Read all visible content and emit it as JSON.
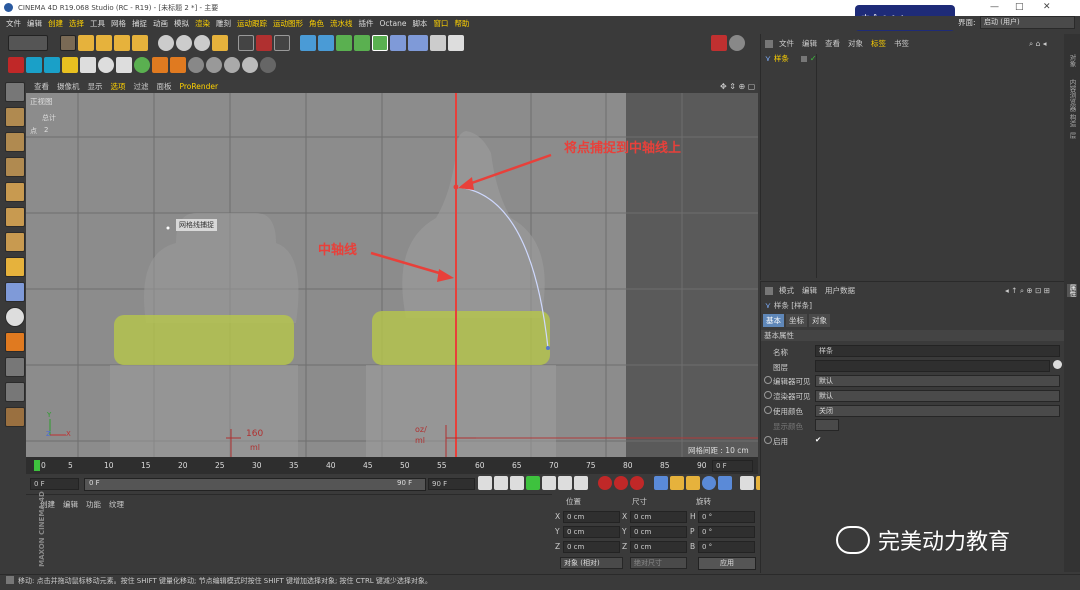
{
  "window": {
    "title": "CINEMA 4D R19.068 Studio (RC - R19) - [未标题 2 *] - 主要",
    "controls": [
      "—",
      "□",
      "✕"
    ]
  },
  "ime": {
    "label": "中 ˚ ☽ ° ✱"
  },
  "menu": [
    "文件",
    "编辑",
    "创建",
    "选择",
    "工具",
    "网格",
    "捕捉",
    "动画",
    "模拟",
    "渲染",
    "雕刻",
    "运动跟踪",
    "运动图形",
    "角色",
    "流水线",
    "插件",
    "Octane",
    "脚本",
    "窗口",
    "帮助"
  ],
  "layout": {
    "label": "界面:",
    "value": "启动 (用户)"
  },
  "viewport": {
    "menu": [
      "查看",
      "摄像机",
      "显示",
      "选项",
      "过滤",
      "面板",
      "ProRender"
    ],
    "view_name": "正视图",
    "stats_label": "总计",
    "points_label": "点",
    "points_value": "2",
    "snap_label": "网格线捕捉",
    "grid_spacing": "网格间距 : 10 cm",
    "annotation_top": "将点捕捉到中轴线上",
    "annotation_mid": "中轴线",
    "bottle_left_text1": "160",
    "bottle_left_text2": "ml",
    "bottle_right_text1": "oz/",
    "bottle_right_text2": "ml",
    "axis_y": "Y",
    "axis_z": "Z",
    "axis_x": "X"
  },
  "timeline": {
    "ticks": [
      "0",
      "5",
      "10",
      "15",
      "20",
      "25",
      "30",
      "35",
      "40",
      "45",
      "50",
      "55",
      "60",
      "65",
      "70",
      "75",
      "80",
      "85",
      "90"
    ],
    "end_field": "0 F"
  },
  "time_controls": {
    "start": "0 F",
    "slider_start": "0 F",
    "slider_end": "90 F",
    "end": "90 F"
  },
  "material": {
    "menu": [
      "创建",
      "编辑",
      "功能",
      "纹理"
    ]
  },
  "coords": {
    "headers": [
      "位置",
      "尺寸",
      "旋转"
    ],
    "rows": [
      {
        "axis": "X",
        "pos": "0 cm",
        "size_axis": "X",
        "size": "0 cm",
        "rot_axis": "H",
        "rot": "0 °"
      },
      {
        "axis": "Y",
        "pos": "0 cm",
        "size_axis": "Y",
        "size": "0 cm",
        "rot_axis": "P",
        "rot": "0 °"
      },
      {
        "axis": "Z",
        "pos": "0 cm",
        "size_axis": "Z",
        "size": "0 cm",
        "rot_axis": "B",
        "rot": "0 °"
      }
    ],
    "mode": "对象 (相对)",
    "size_mode": "绝对尺寸",
    "apply": "应用"
  },
  "status": "移动: 点击并拖动鼠标移动元素。按住 SHIFT 键量化移动; 节点编辑模式时按住 SHIFT 键增加选择对象; 按住 CTRL 键减少选择对象。",
  "object_manager": {
    "menu": [
      "文件",
      "编辑",
      "查看",
      "对象",
      "标签",
      "书签"
    ],
    "objects": [
      {
        "name": "样条"
      }
    ]
  },
  "attr_manager": {
    "menu": [
      "模式",
      "编辑",
      "用户数据"
    ],
    "object_title": "样条 [样条]",
    "tabs": [
      "基本",
      "坐标",
      "对象"
    ],
    "section": "基本属性",
    "fields": [
      {
        "label": "名称",
        "value": "样条"
      },
      {
        "label": "图层",
        "value": ""
      },
      {
        "label": "编辑器可见",
        "value": "默认"
      },
      {
        "label": "渲染器可见",
        "value": "默认"
      },
      {
        "label": "使用颜色",
        "value": "关闭"
      },
      {
        "label": "显示颜色",
        "value": ""
      },
      {
        "label": "启用",
        "value": "✔"
      }
    ]
  },
  "right_tabs": [
    "对象",
    "内容浏览器",
    "构造",
    "层"
  ],
  "right_tab_attr": "属性",
  "watermark": "完美动力教育",
  "maxon": "MAXON CINEMA 4D",
  "colors": {
    "accent_yellow": "#ffd200",
    "annotation_red": "#e8403a",
    "tab_blue": "#5f87b8",
    "bottle_green": "#b7c74a"
  }
}
